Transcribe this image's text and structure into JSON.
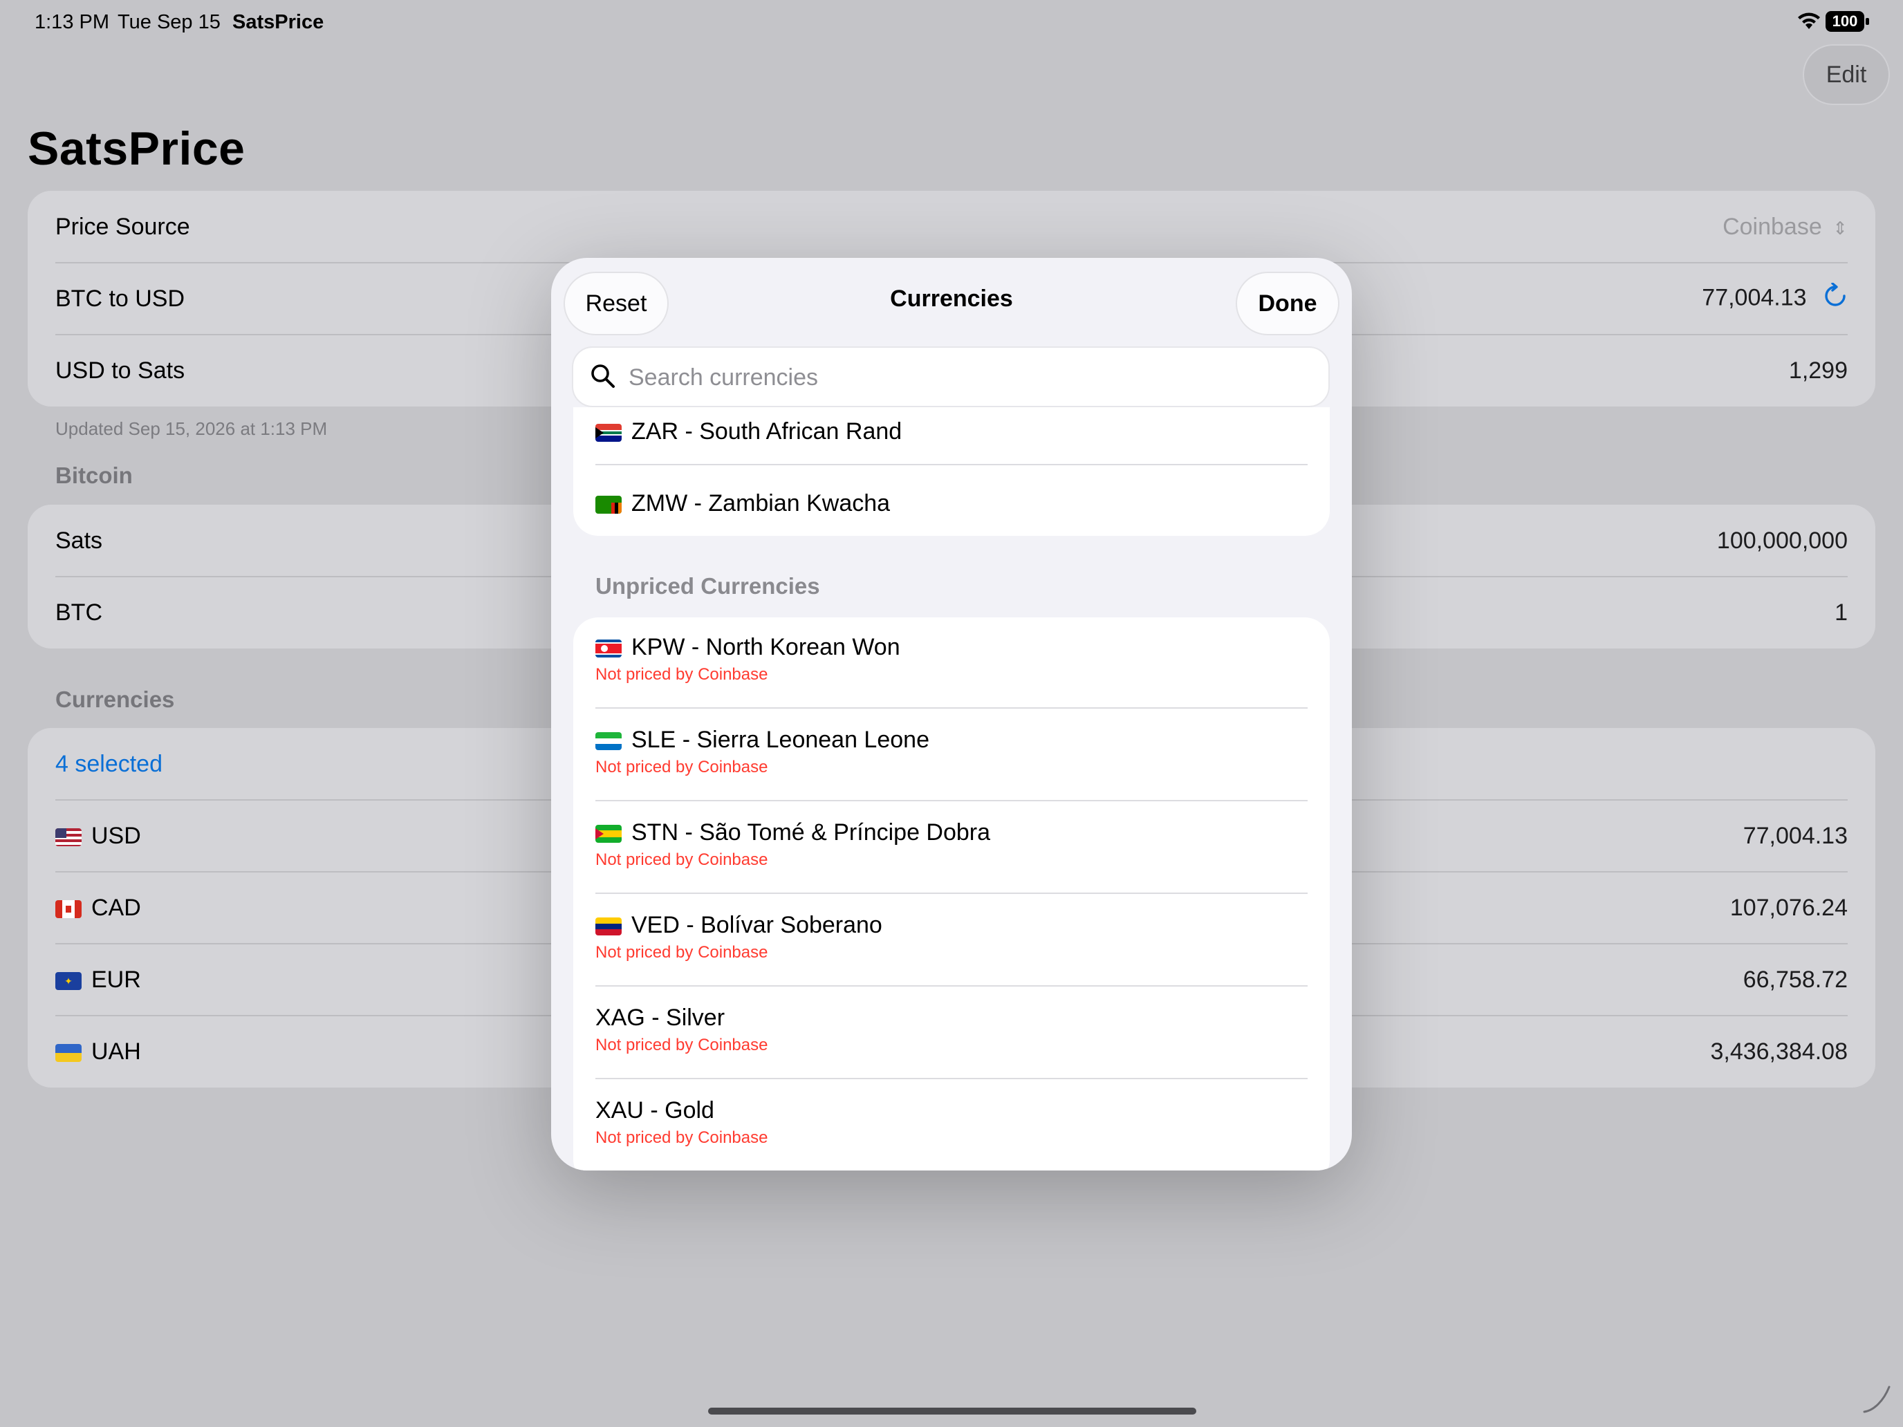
{
  "status_bar": {
    "time": "1:13 PM",
    "date": "Tue Sep 15",
    "app": "SatsPrice",
    "battery": "100",
    "wifi_icon": "wifi-icon"
  },
  "header": {
    "edit_label": "Edit",
    "title": "SatsPrice"
  },
  "price_card": {
    "source_label": "Price Source",
    "source_value": "Coinbase",
    "btc_usd_label": "BTC to USD",
    "btc_usd_value": "77,004.13",
    "usd_sats_label": "USD to Sats",
    "usd_sats_value": "1,299",
    "updated": "Updated Sep 15, 2026 at 1:13 PM"
  },
  "bitcoin_section": {
    "label": "Bitcoin",
    "rows": [
      {
        "label": "Sats",
        "value": "100,000,000"
      },
      {
        "label": "BTC",
        "value": "1"
      }
    ]
  },
  "currencies_section": {
    "label": "Currencies",
    "selected": "4 selected",
    "rows": [
      {
        "code": "USD",
        "value": "77,004.13"
      },
      {
        "code": "CAD",
        "value": "107,076.24"
      },
      {
        "code": "EUR",
        "value": "66,758.72"
      },
      {
        "code": "UAH",
        "value": "3,436,384.08"
      }
    ]
  },
  "modal": {
    "reset_label": "Reset",
    "title": "Currencies",
    "done_label": "Done",
    "search_placeholder": "Search currencies",
    "priced": [
      {
        "name": "ZAR - South African Rand"
      },
      {
        "name": "ZMW - Zambian Kwacha"
      }
    ],
    "unpriced_header": "Unpriced Currencies",
    "unpriced": [
      {
        "name": "KPW - North Korean Won",
        "note": "Not priced by Coinbase"
      },
      {
        "name": "SLE - Sierra Leonean Leone",
        "note": "Not priced by Coinbase"
      },
      {
        "name": "STN - São Tomé & Príncipe Dobra",
        "note": "Not priced by Coinbase"
      },
      {
        "name": "VED - Bolívar Soberano",
        "note": "Not priced by Coinbase"
      },
      {
        "name": "XAG - Silver",
        "note": "Not priced by Coinbase"
      },
      {
        "name": "XAU - Gold",
        "note": "Not priced by Coinbase"
      }
    ]
  },
  "colors": {
    "accent": "#0a6fd6",
    "error": "#ff3b30"
  }
}
